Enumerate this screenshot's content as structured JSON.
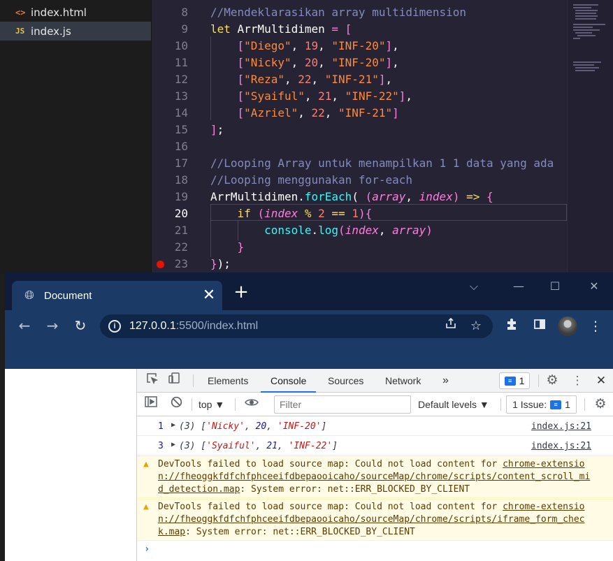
{
  "explorer": {
    "files": [
      {
        "icon": "<>",
        "name": "index.html"
      },
      {
        "icon": "JS",
        "name": "index.js"
      }
    ]
  },
  "editor": {
    "lines": [
      {
        "num": "8",
        "tokens": [
          [
            "cm",
            "//Mendeklarasikan array multidimension"
          ]
        ]
      },
      {
        "num": "9",
        "tokens": [
          [
            "kw",
            "let "
          ],
          [
            "id",
            "ArrMultidimen"
          ],
          [
            "br",
            " = ["
          ]
        ]
      },
      {
        "num": "10",
        "tokens": [
          [
            "id",
            "    "
          ],
          [
            "br",
            "["
          ],
          [
            "str",
            "\"Diego\""
          ],
          [
            "id",
            ", "
          ],
          [
            "num",
            "19"
          ],
          [
            "id",
            ", "
          ],
          [
            "str",
            "\"INF-20\""
          ],
          [
            "br",
            "]"
          ],
          [
            "id",
            ","
          ]
        ]
      },
      {
        "num": "11",
        "tokens": [
          [
            "id",
            "    "
          ],
          [
            "br",
            "["
          ],
          [
            "str",
            "\"Nicky\""
          ],
          [
            "id",
            ", "
          ],
          [
            "num",
            "20"
          ],
          [
            "id",
            ", "
          ],
          [
            "str",
            "\"INF-20\""
          ],
          [
            "br",
            "]"
          ],
          [
            "id",
            ","
          ]
        ]
      },
      {
        "num": "12",
        "tokens": [
          [
            "id",
            "    "
          ],
          [
            "br",
            "["
          ],
          [
            "str",
            "\"Reza\""
          ],
          [
            "id",
            ", "
          ],
          [
            "num",
            "22"
          ],
          [
            "id",
            ", "
          ],
          [
            "str",
            "\"INF-21\""
          ],
          [
            "br",
            "]"
          ],
          [
            "id",
            ","
          ]
        ]
      },
      {
        "num": "13",
        "tokens": [
          [
            "id",
            "    "
          ],
          [
            "br",
            "["
          ],
          [
            "str",
            "\"Syaiful\""
          ],
          [
            "id",
            ", "
          ],
          [
            "num",
            "21"
          ],
          [
            "id",
            ", "
          ],
          [
            "str",
            "\"INF-22\""
          ],
          [
            "br",
            "]"
          ],
          [
            "id",
            ","
          ]
        ]
      },
      {
        "num": "14",
        "tokens": [
          [
            "id",
            "    "
          ],
          [
            "br",
            "["
          ],
          [
            "str",
            "\"Azriel\""
          ],
          [
            "id",
            ", "
          ],
          [
            "num",
            "22"
          ],
          [
            "id",
            ", "
          ],
          [
            "str",
            "\"INF-21\""
          ],
          [
            "br",
            "]"
          ]
        ]
      },
      {
        "num": "15",
        "tokens": [
          [
            "br",
            "]"
          ],
          [
            "id",
            ";"
          ]
        ]
      },
      {
        "num": "16",
        "tokens": []
      },
      {
        "num": "17",
        "tokens": [
          [
            "cm",
            "//Looping Array untuk menampilkan 1 1 data yang ada"
          ]
        ]
      },
      {
        "num": "18",
        "tokens": [
          [
            "cm",
            "//Looping menggunakan for-each"
          ]
        ]
      },
      {
        "num": "19",
        "tokens": [
          [
            "id",
            "ArrMultidimen"
          ],
          [
            "id",
            "."
          ],
          [
            "fn",
            "forEach"
          ],
          [
            "id",
            "( "
          ],
          [
            "br",
            "("
          ],
          [
            "var",
            "array"
          ],
          [
            "id",
            ", "
          ],
          [
            "var",
            "index"
          ],
          [
            "br",
            ")"
          ],
          [
            "kw",
            " => "
          ],
          [
            "br",
            "{"
          ]
        ]
      },
      {
        "num": "20",
        "tokens": [
          [
            "id",
            "    "
          ],
          [
            "kw",
            "if "
          ],
          [
            "br",
            "("
          ],
          [
            "var",
            "index"
          ],
          [
            "kw",
            " % "
          ],
          [
            "num",
            "2"
          ],
          [
            "kw",
            " == "
          ],
          [
            "num",
            "1"
          ],
          [
            "br",
            ")"
          ],
          [
            "br",
            "{"
          ]
        ]
      },
      {
        "num": "21",
        "tokens": [
          [
            "id",
            "        "
          ],
          [
            "fn",
            "console"
          ],
          [
            "id",
            "."
          ],
          [
            "fn",
            "log"
          ],
          [
            "br",
            "("
          ],
          [
            "var",
            "index"
          ],
          [
            "id",
            ", "
          ],
          [
            "var",
            "array"
          ],
          [
            "br",
            ")"
          ]
        ]
      },
      {
        "num": "22",
        "tokens": [
          [
            "id",
            "    "
          ],
          [
            "br",
            "}"
          ]
        ]
      },
      {
        "num": "23",
        "tokens": [
          [
            "br",
            "}"
          ],
          [
            "id",
            ");"
          ]
        ]
      }
    ],
    "current_line": "20",
    "breakpoint_line": "23"
  },
  "browser": {
    "tab_title": "Document",
    "tab_close": "✕",
    "new_tab": "+",
    "window_controls": {
      "tab_search": "⌵",
      "minimize": "—",
      "maximize": "☐",
      "close": "✕"
    },
    "url_host": "127.0.0.1",
    "url_rest": ":5500/index.html",
    "info_glyph": "i"
  },
  "devtools": {
    "tabs": [
      "Elements",
      "Console",
      "Sources",
      "Network"
    ],
    "active_tab": "Console",
    "more_tabs": "»",
    "messages_count": "1",
    "context": "top",
    "filter_placeholder": "Filter",
    "levels": "Default levels",
    "issues": "1 Issue:",
    "issues_count": "1",
    "console": {
      "logs": [
        {
          "index": "1",
          "prefix": "(3) [",
          "s1": "'Nicky'",
          "sep1": ", ",
          "n": "20",
          "sep2": ", ",
          "s2": "'INF-20'",
          "suffix": "]",
          "source": "index.js:21"
        },
        {
          "index": "3",
          "prefix": "(3) [",
          "s1": "'Syaiful'",
          "sep1": ", ",
          "n": "21",
          "sep2": ", ",
          "s2": "'INF-22'",
          "suffix": "]",
          "source": "index.js:21"
        }
      ],
      "warnings": [
        {
          "prefix": "DevTools failed to load source map: Could not load content for ",
          "link": "chrome-extension://fheoggkfdfchfphceeifdbepaooicaho/sourceMap/chrome/scripts/content_scroll_mid_detection.map",
          "suffix": ": System error: net::ERR_BLOCKED_BY_CLIENT"
        },
        {
          "prefix": "DevTools failed to load source map: Could not load content for ",
          "link": "chrome-extension://fheoggkfdfchfphceeifdbepaooicaho/sourceMap/chrome/scripts/iframe_form_check.map",
          "suffix": ": System error: net::ERR_BLOCKED_BY_CLIENT"
        }
      ],
      "prompt": "›"
    }
  },
  "colors": {
    "editor_bg": "#262335",
    "browser_frame": "#1c3a66",
    "devtools_accent": "#1a73e8",
    "warning_bg": "#fffbe5",
    "breakpoint": "#e51400"
  },
  "icons": {
    "tab_favicon": "globe-icon",
    "back": "arrow-left-icon",
    "forward": "arrow-right-icon",
    "reload": "reload-icon",
    "share": "share-icon",
    "bookmark": "star-icon",
    "extensions": "puzzle-icon",
    "sidepanel": "side-panel-icon",
    "menu": "kebab-menu-icon",
    "inspect": "inspect-icon",
    "device": "device-toggle-icon",
    "settings": "gear-icon",
    "clear": "clear-console-icon",
    "eye": "eye-icon",
    "warning": "warning-icon"
  }
}
